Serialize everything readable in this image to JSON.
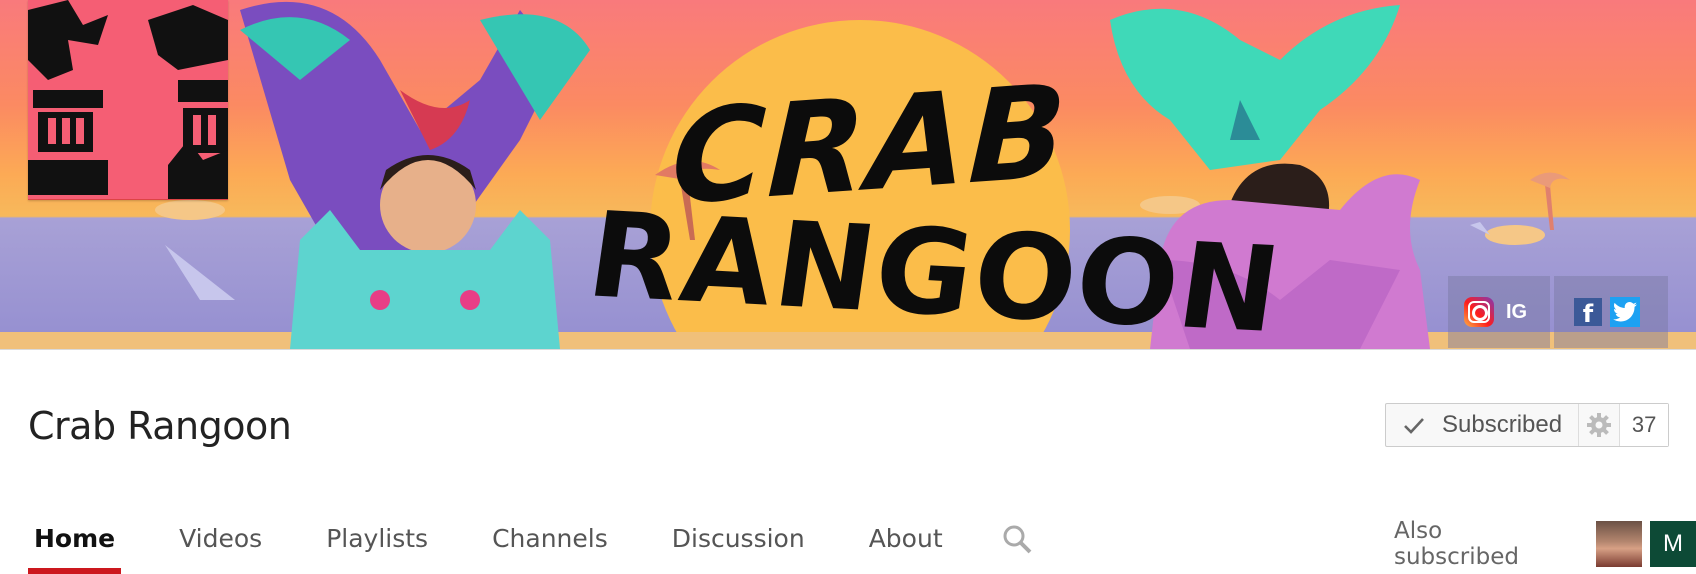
{
  "banner": {
    "logo_line1": "CRAB",
    "logo_line2": "RANGOON",
    "links": [
      {
        "name": "Instagram",
        "icon": "instagram-icon",
        "label": "IG"
      },
      {
        "name": "Facebook",
        "icon": "facebook-icon",
        "label": ""
      },
      {
        "name": "Twitter",
        "icon": "twitter-icon",
        "label": ""
      }
    ]
  },
  "channel": {
    "name": "Crab Rangoon"
  },
  "subscribe": {
    "label": "Subscribed",
    "check_icon": "checkmark-icon",
    "settings_icon": "gear-icon",
    "count": "37"
  },
  "tabs": [
    {
      "label": "Home",
      "active": true
    },
    {
      "label": "Videos",
      "active": false
    },
    {
      "label": "Playlists",
      "active": false
    },
    {
      "label": "Channels",
      "active": false
    },
    {
      "label": "Discussion",
      "active": false
    },
    {
      "label": "About",
      "active": false
    }
  ],
  "search_icon": "search-icon",
  "also_subscribed": {
    "label": "Also subscribed",
    "avatars": [
      {
        "type": "photo",
        "letter": ""
      },
      {
        "type": "letter",
        "letter": "M"
      }
    ]
  },
  "colors": {
    "active_tab_underline": "#cc181e",
    "facebook": "#3b5998",
    "twitter": "#1da1f2",
    "avatar_m_bg": "#0d4a36"
  }
}
